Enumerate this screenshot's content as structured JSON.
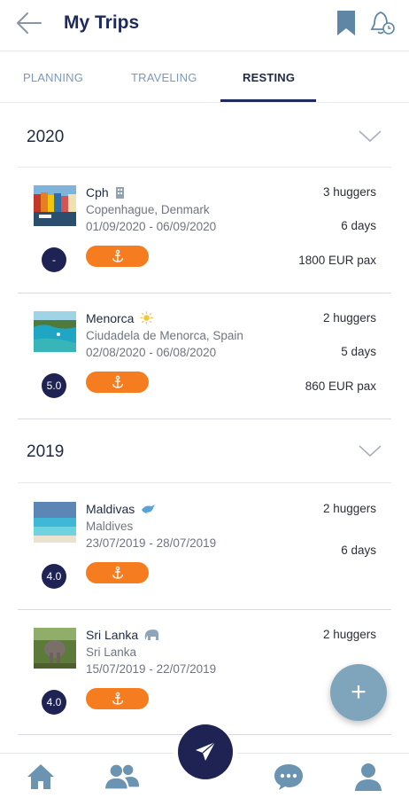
{
  "header": {
    "title": "My Trips",
    "back_icon": "arrow-left-icon",
    "bookmark_icon": "bookmark-icon",
    "alarm_icon": "alarm-bell-icon"
  },
  "tabs": [
    {
      "label": "PLANNING",
      "active": false
    },
    {
      "label": "TRAVELING",
      "active": false
    },
    {
      "label": "RESTING",
      "active": true
    }
  ],
  "sections": [
    {
      "year": "2020",
      "trips": [
        {
          "name": "Cph",
          "name_icon": "building-icon",
          "place": "Copenhague, Denmark",
          "dates": "01/09/2020 - 06/09/2020",
          "huggers": "3 huggers",
          "days": "6 days",
          "price": "1800 EUR pax",
          "score": "-"
        },
        {
          "name": "Menorca",
          "name_icon": "sun-icon",
          "place": "Ciudadela de Menorca, Spain",
          "dates": "02/08/2020 - 06/08/2020",
          "huggers": "2 huggers",
          "days": "5 days",
          "price": "860 EUR pax",
          "score": "5.0"
        }
      ]
    },
    {
      "year": "2019",
      "trips": [
        {
          "name": "Maldivas",
          "name_icon": "dolphin-icon",
          "place": "Maldives",
          "dates": "23/07/2019 - 28/07/2019",
          "huggers": "2 huggers",
          "days": "6 days",
          "price": "",
          "score": "4.0"
        },
        {
          "name": "Sri Lanka",
          "name_icon": "elephant-icon",
          "place": "Sri Lanka",
          "dates": "15/07/2019 - 22/07/2019",
          "huggers": "2 huggers",
          "days": "",
          "price": "",
          "score": "4.0"
        }
      ]
    }
  ],
  "fab": {
    "label": "+"
  },
  "bottom_nav": [
    "home-icon",
    "users-icon",
    "send-icon",
    "chat-icon",
    "profile-icon"
  ],
  "colors": {
    "navy": "#1f2354",
    "orange": "#f57c1f",
    "fab": "#7fa5bd",
    "tab_inactive": "#7f98b6",
    "icon_blue": "#5f87a5"
  }
}
